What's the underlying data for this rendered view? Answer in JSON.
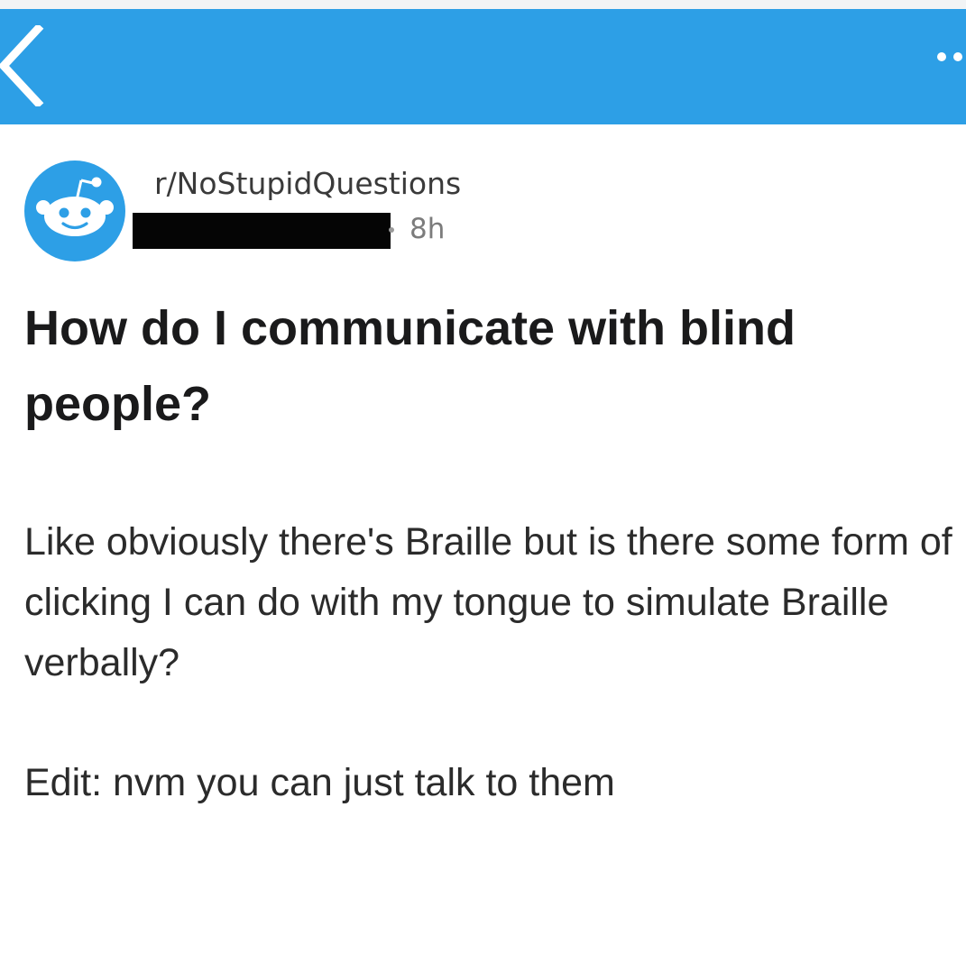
{
  "colors": {
    "header_bar": "#2d9fe6",
    "avatar_background": "#2d9fe6",
    "redaction": "#050505",
    "title_text": "#1a1a1b",
    "body_text": "#2b2b2b",
    "meta_text": "#7c7c7c"
  },
  "header": {
    "back_icon": "chevron-left-icon",
    "more_icon": "more-dots-icon"
  },
  "post": {
    "subreddit": "r/NoStupidQuestions",
    "author": "",
    "age": "8h",
    "avatar_icon": "reddit-snoo-icon",
    "title": "How do I communicate with blind people?",
    "body": [
      "Like obviously there's Braille but is there some form of clicking I can do with my tongue to simulate Braille verbally?",
      "Edit: nvm you can just talk to them"
    ]
  }
}
